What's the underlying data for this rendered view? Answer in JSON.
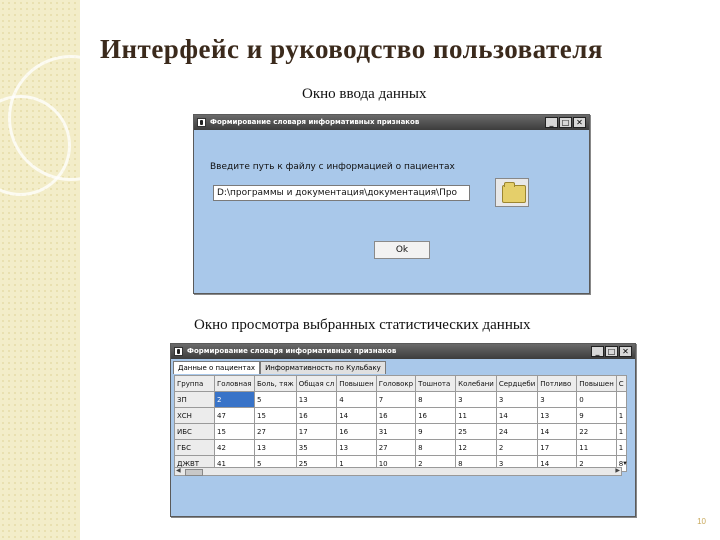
{
  "slide": {
    "title": "Интерфейс и руководство пользователя",
    "caption_input": "Окно ввода данных",
    "caption_view": "Окно просмотра выбранных статистических данных",
    "page_number": "10"
  },
  "input_window": {
    "title": "Формирование словаря информативных признаков",
    "prompt": "Введите путь к файлу с информацией о пациентах",
    "path_value": "D:\\программы и документация\\документация\\Про",
    "ok_label": "Ok",
    "folder_icon": "folder-icon"
  },
  "view_window": {
    "title": "Формирование словаря информативных признаков",
    "tabs": [
      "Данные о пациентах",
      "Информативность по Кульбаку"
    ],
    "columns": [
      "Группа",
      "Головная",
      "Боль, тяж",
      "Общая сл",
      "Повышен",
      "Головокр",
      "Тошнота",
      "Колебани",
      "Сердцеби",
      "Потливо",
      "Повышен",
      "С"
    ],
    "rows": [
      [
        "ЗП",
        "2",
        "5",
        "13",
        "4",
        "7",
        "8",
        "3",
        "3",
        "3",
        "0"
      ],
      [
        "ХСН",
        "47",
        "15",
        "16",
        "14",
        "16",
        "16",
        "11",
        "14",
        "13",
        "9",
        "1"
      ],
      [
        "ИБС",
        "15",
        "27",
        "17",
        "16",
        "31",
        "9",
        "25",
        "24",
        "14",
        "22",
        "1"
      ],
      [
        "ГБС",
        "42",
        "13",
        "35",
        "13",
        "27",
        "8",
        "12",
        "2",
        "17",
        "11",
        "1"
      ],
      [
        "ДЖВТ",
        "41",
        "5",
        "25",
        "1",
        "10",
        "2",
        "8",
        "3",
        "14",
        "2",
        "8"
      ]
    ]
  }
}
